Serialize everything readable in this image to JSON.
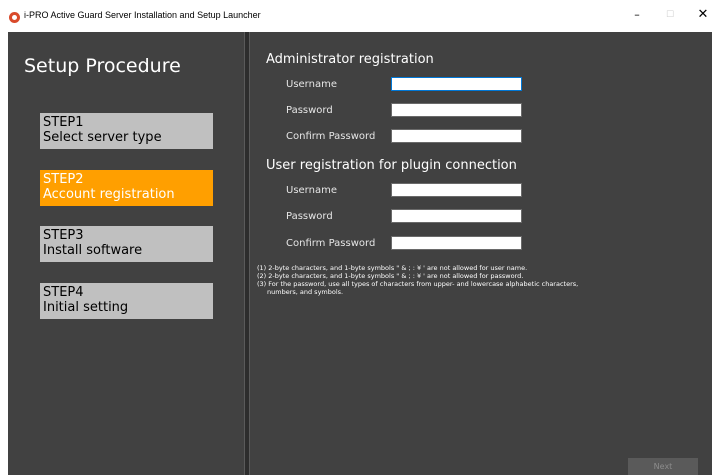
{
  "window": {
    "title": "i-PRO Active Guard Server Installation and Setup Launcher",
    "minimize_glyph": "–",
    "maximize_glyph": "☐",
    "close_glyph": "✕",
    "icon": "app-logo-icon"
  },
  "sidebar": {
    "title": "Setup Procedure",
    "steps": [
      {
        "step": "STEP1",
        "label": "Select server type",
        "active": false
      },
      {
        "step": "STEP2",
        "label": "Account registration",
        "active": true
      },
      {
        "step": "STEP3",
        "label": "Install software",
        "active": false
      },
      {
        "step": "STEP4",
        "label": "Initial setting",
        "active": false
      }
    ]
  },
  "admin": {
    "title": "Administrator registration",
    "username_label": "Username",
    "password_label": "Password",
    "confirm_label": "Confirm Password",
    "username_value": "",
    "password_value": "",
    "confirm_value": ""
  },
  "plugin_user": {
    "title": "User registration for plugin connection",
    "username_label": "Username",
    "password_label": "Password",
    "confirm_label": "Confirm Password",
    "username_value": "",
    "password_value": "",
    "confirm_value": ""
  },
  "notes": [
    "(1) 2-byte characters, and 1-byte symbols \" & ; : ¥ ' are not allowed for user name.",
    "(2) 2-byte characters, and 1-byte symbols \" & ; : ¥ ' are not allowed for password.",
    "(3) For the password, use all types of characters from upper- and lowercase alphabetic characters,",
    "numbers, and symbols."
  ],
  "footer": {
    "next_label": "Next"
  },
  "colors": {
    "background": "#414141",
    "active_step": "#ff9f00",
    "inactive_step": "#c0c0c0",
    "app_icon": "#d94a2b"
  }
}
